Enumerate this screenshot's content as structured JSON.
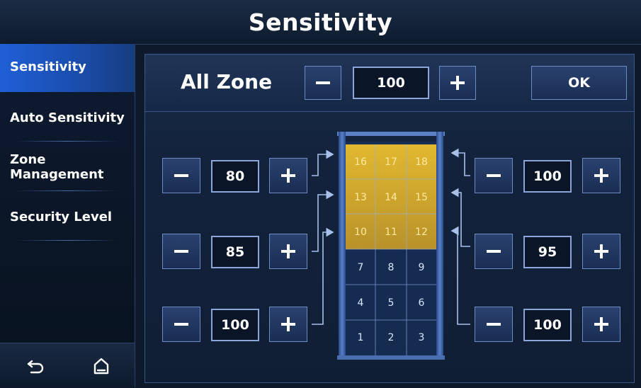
{
  "header": {
    "title": "Sensitivity"
  },
  "sidebar": {
    "items": [
      {
        "label": "Sensitivity",
        "active": true
      },
      {
        "label": "Auto Sensitivity",
        "active": false
      },
      {
        "label": "Zone Management",
        "active": false
      },
      {
        "label": "Security Level",
        "active": false
      }
    ]
  },
  "bottom_nav": {
    "back_icon": "back-arrow-icon",
    "home_icon": "home-icon"
  },
  "all_zone": {
    "label": "All Zone",
    "value": "100",
    "ok_label": "OK"
  },
  "left_controls": [
    {
      "value": "80"
    },
    {
      "value": "85"
    },
    {
      "value": "100"
    }
  ],
  "right_controls": [
    {
      "value": "100"
    },
    {
      "value": "95"
    },
    {
      "value": "100"
    }
  ],
  "zones": {
    "rows": [
      [
        "16",
        "17",
        "18"
      ],
      [
        "13",
        "14",
        "15"
      ],
      [
        "10",
        "11",
        "12"
      ],
      [
        "7",
        "8",
        "9"
      ],
      [
        "4",
        "5",
        "6"
      ],
      [
        "1",
        "2",
        "3"
      ]
    ],
    "highlighted": [
      "10",
      "11",
      "12",
      "13",
      "14",
      "15",
      "16",
      "17",
      "18"
    ]
  },
  "colors": {
    "accent_blue": "#1f5fd6",
    "zone_highlight": "#c9a72a",
    "panel_border": "#3a5886",
    "connector": "#a8c0e8"
  }
}
